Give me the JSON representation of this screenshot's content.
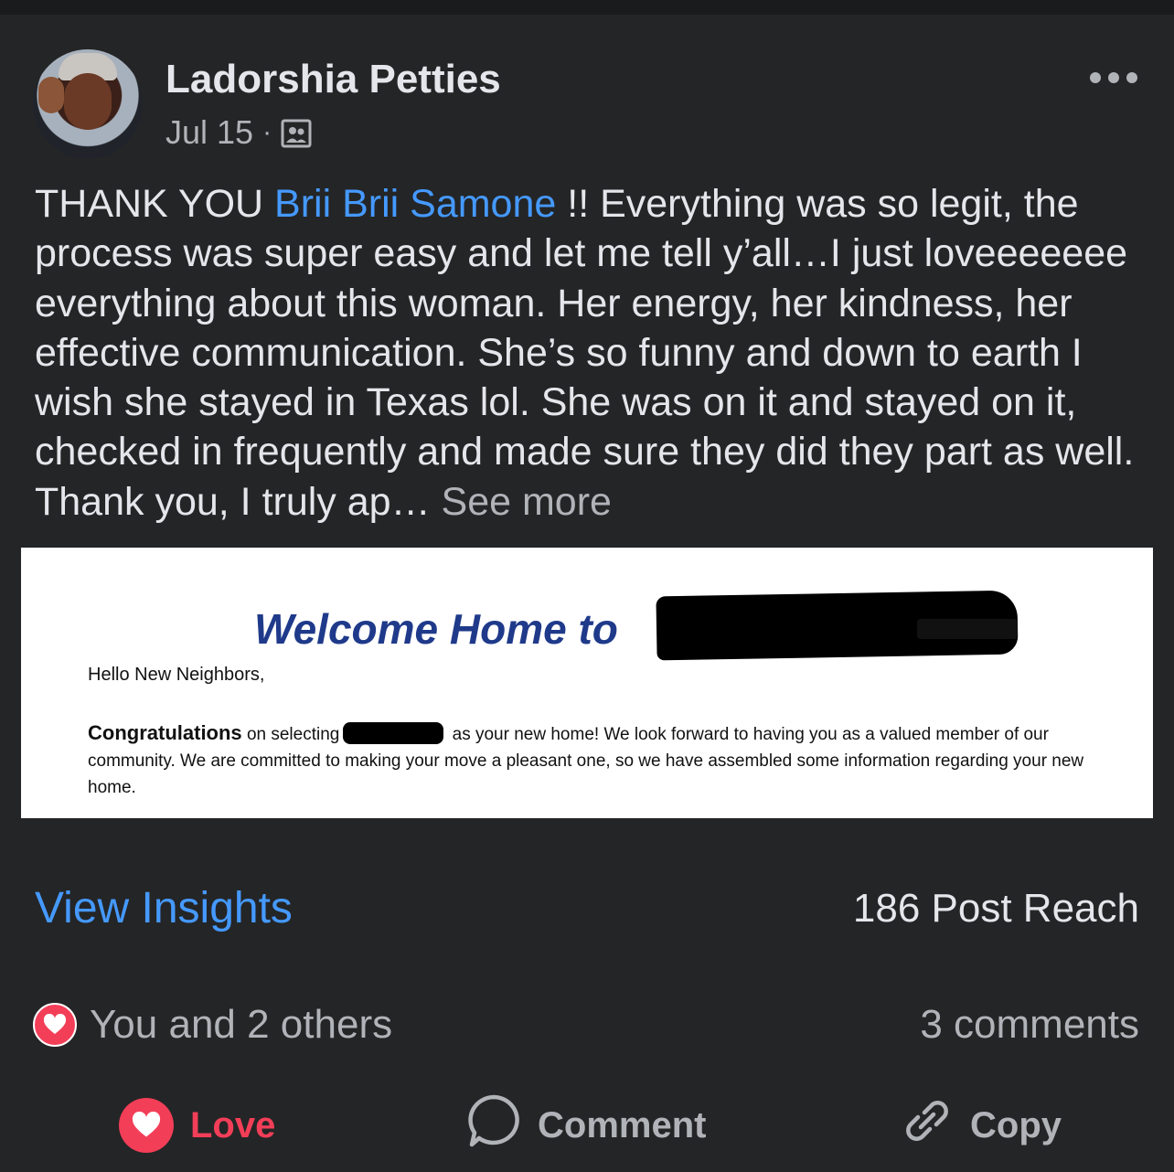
{
  "post": {
    "author": "Ladorshia Petties",
    "date": "Jul 15",
    "separator": "·",
    "audience_icon": "group-audience-icon",
    "text_before_mention": "THANK YOU ",
    "mention": "Brii Brii Samone",
    "text_after_mention": " !! Everything was so legit, the process was super easy and let me tell y’all…I just loveeeeeee everything about this woman. Her energy, her kindness, her effective communication. She’s so funny and down to earth I wish she stayed in Texas lol. She was on it and stayed on it, checked in frequently and made sure they did they part as well. Thank you, I truly ap… ",
    "see_more": "See more"
  },
  "attachment": {
    "title": "Welcome Home to",
    "greeting": "Hello New Neighbors,",
    "lead_bold": "Congratulations",
    "lead_text": " on selecting",
    "body": " as your new home! We look forward to having you as a valued member of our community. We are committed to making your move a pleasant one, so we have assembled some information regarding your new home."
  },
  "insights": {
    "link": "View Insights",
    "reach": "186 Post Reach"
  },
  "reactions": {
    "summary": "You and 2 others",
    "comments": "3 comments"
  },
  "actions": {
    "love": "Love",
    "comment": "Comment",
    "copy": "Copy"
  },
  "colors": {
    "background": "#242526",
    "link_blue": "#4599ff",
    "love_red": "#f33e58",
    "secondary_text": "#b0b3b8",
    "primary_text": "#e4e6eb"
  }
}
